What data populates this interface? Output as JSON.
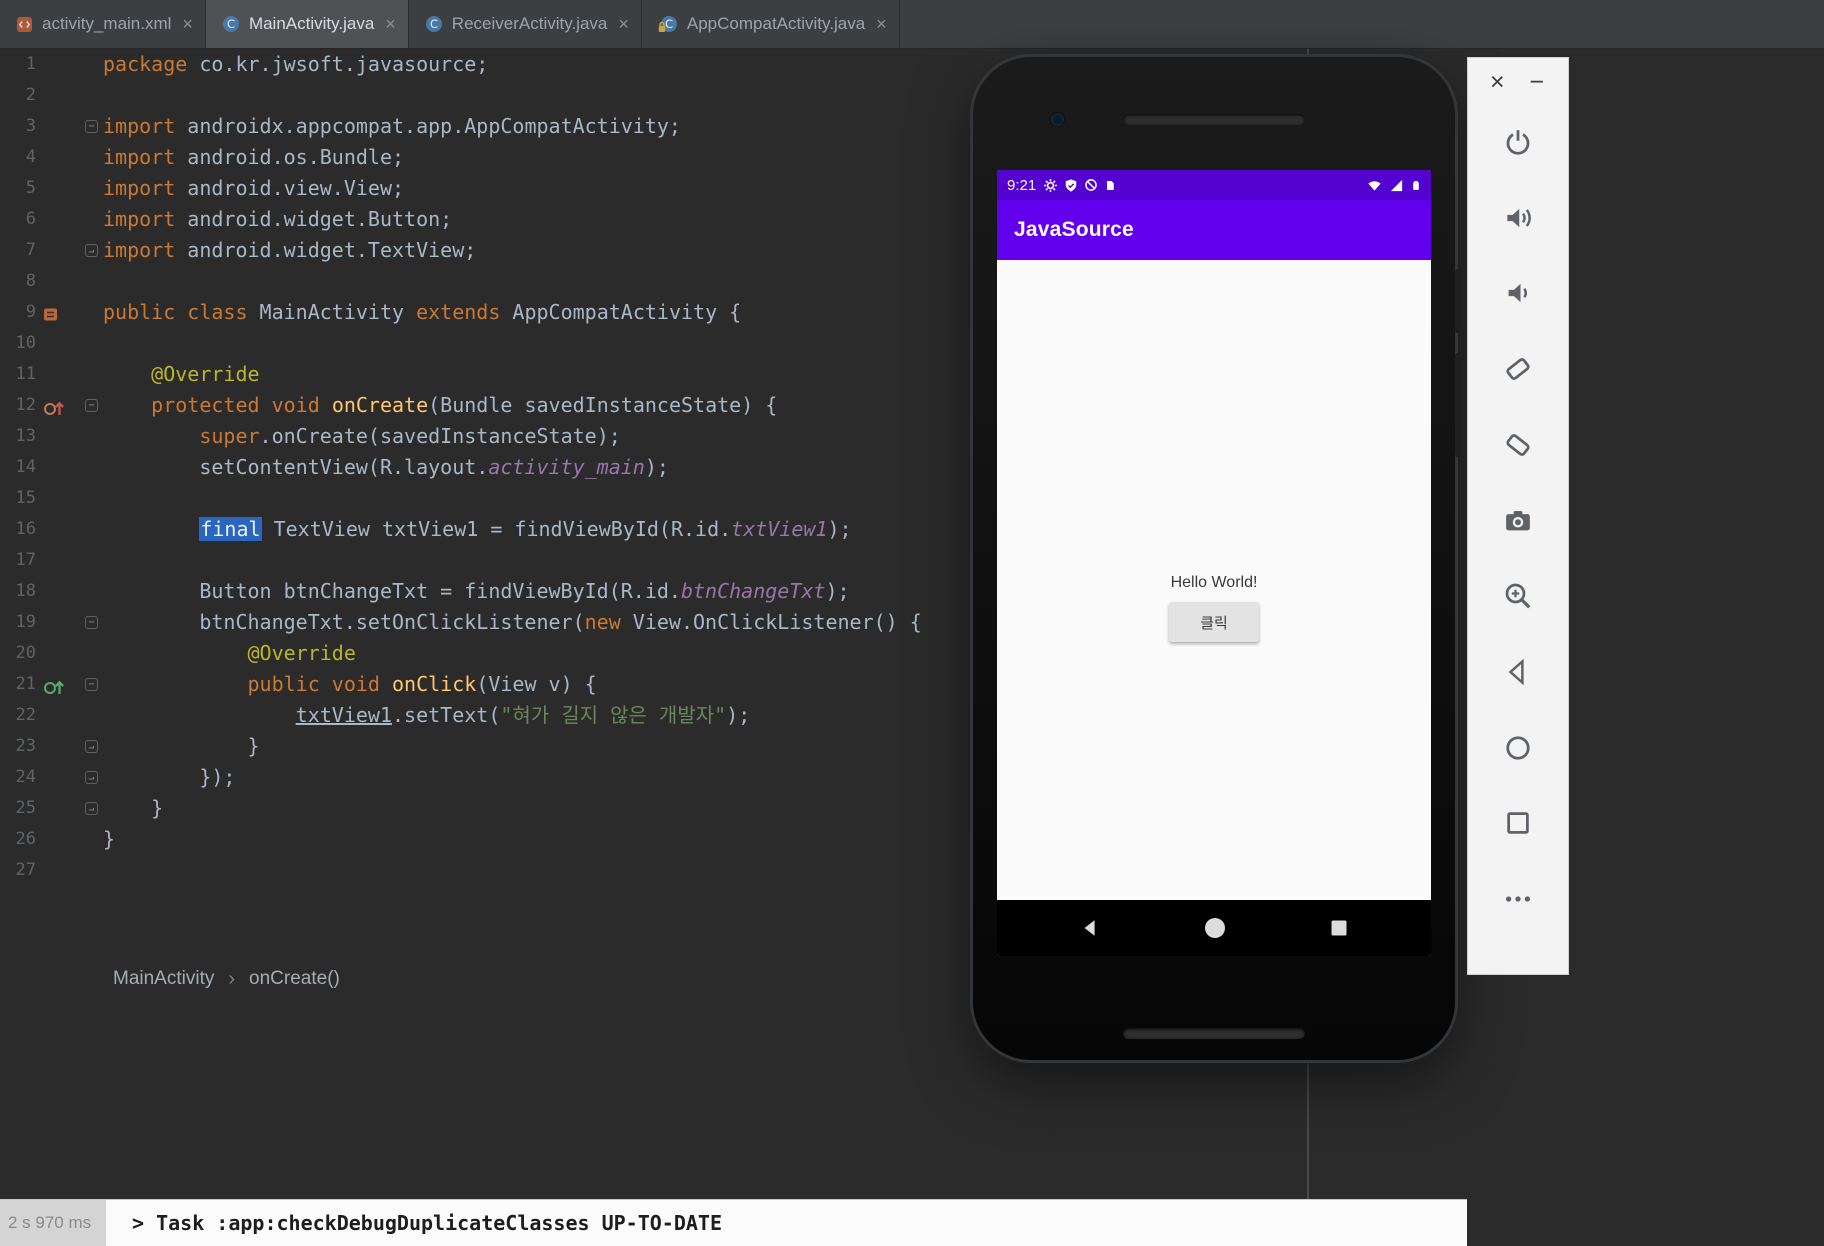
{
  "ui": {
    "close_glyph": "×",
    "minimize_glyph": "−",
    "breadcrumb_separator": "›",
    "fold_start_glyph": "−",
    "fold_end_glyph": "⌐"
  },
  "tabs": [
    {
      "label": "activity_main.xml",
      "icon": "xml-file-icon",
      "active": false
    },
    {
      "label": "MainActivity.java",
      "icon": "java-class-icon",
      "active": true
    },
    {
      "label": "ReceiverActivity.java",
      "icon": "java-class-icon",
      "active": false
    },
    {
      "label": "AppCompatActivity.java",
      "icon": "java-class-locked-icon",
      "active": false
    }
  ],
  "editor": {
    "lines": [
      {
        "n": 1,
        "tokens": [
          [
            "package",
            "k"
          ],
          [
            " co.kr.jwsoft.javasource;",
            "d"
          ]
        ]
      },
      {
        "n": 2,
        "tokens": []
      },
      {
        "n": 3,
        "fold": "start",
        "tokens": [
          [
            "import",
            "k"
          ],
          [
            " androidx.appcompat.app.AppCompatActivity;",
            "d"
          ]
        ]
      },
      {
        "n": 4,
        "tokens": [
          [
            "import",
            "k"
          ],
          [
            " android.os.Bundle;",
            "d"
          ]
        ]
      },
      {
        "n": 5,
        "tokens": [
          [
            "import",
            "k"
          ],
          [
            " android.view.View;",
            "d"
          ]
        ]
      },
      {
        "n": 6,
        "tokens": [
          [
            "import",
            "k"
          ],
          [
            " android.widget.Button;",
            "d"
          ]
        ]
      },
      {
        "n": 7,
        "fold": "end",
        "tokens": [
          [
            "import",
            "k"
          ],
          [
            " android.widget.TextView;",
            "d"
          ]
        ]
      },
      {
        "n": 8,
        "tokens": []
      },
      {
        "n": 9,
        "gutter_icon": "class-marker-icon",
        "tokens": [
          [
            "public",
            "k"
          ],
          [
            " ",
            "d"
          ],
          [
            "class",
            "k"
          ],
          [
            " MainActivity ",
            "d"
          ],
          [
            "extends",
            "k"
          ],
          [
            " AppCompatActivity {",
            "d"
          ]
        ]
      },
      {
        "n": 10,
        "tokens": []
      },
      {
        "n": 11,
        "tokens": [
          [
            "    ",
            "d"
          ],
          [
            "@Override",
            "a"
          ]
        ]
      },
      {
        "n": 12,
        "gutter_icon": "override-marker-red-icon",
        "fold": "start",
        "tokens": [
          [
            "    ",
            "d"
          ],
          [
            "protected",
            "k"
          ],
          [
            " ",
            "d"
          ],
          [
            "void",
            "k"
          ],
          [
            " ",
            "d"
          ],
          [
            "onCreate",
            "m"
          ],
          [
            "(Bundle savedInstanceState) {",
            "d"
          ]
        ]
      },
      {
        "n": 13,
        "tokens": [
          [
            "        ",
            "d"
          ],
          [
            "super",
            "k"
          ],
          [
            ".onCreate(savedInstanceState);",
            "d"
          ]
        ]
      },
      {
        "n": 14,
        "tokens": [
          [
            "        setContentView(R.layout.",
            "d"
          ],
          [
            "activity_main",
            "f"
          ],
          [
            ");",
            "d"
          ]
        ]
      },
      {
        "n": 15,
        "tokens": []
      },
      {
        "n": 16,
        "tokens": [
          [
            "        ",
            "d"
          ],
          [
            "final",
            "sel"
          ],
          [
            " TextView txtView1 = findViewById(R.id.",
            "d"
          ],
          [
            "txtView1",
            "f"
          ],
          [
            ");",
            "d"
          ]
        ]
      },
      {
        "n": 17,
        "tokens": []
      },
      {
        "n": 18,
        "tokens": [
          [
            "        Button btnChangeTxt = findViewById(R.id.",
            "d"
          ],
          [
            "btnChangeTxt",
            "f"
          ],
          [
            ");",
            "d"
          ]
        ]
      },
      {
        "n": 19,
        "fold": "start",
        "tokens": [
          [
            "        btnChangeTxt.setOnClickListener(",
            "d"
          ],
          [
            "new",
            "k"
          ],
          [
            " View.OnClickListener() {",
            "d"
          ]
        ]
      },
      {
        "n": 20,
        "tokens": [
          [
            "            ",
            "d"
          ],
          [
            "@Override",
            "a"
          ]
        ]
      },
      {
        "n": 21,
        "gutter_icon": "override-marker-green-icon",
        "fold": "start",
        "tokens": [
          [
            "            ",
            "d"
          ],
          [
            "public",
            "k"
          ],
          [
            " ",
            "d"
          ],
          [
            "void",
            "k"
          ],
          [
            " ",
            "d"
          ],
          [
            "onClick",
            "m"
          ],
          [
            "(View v) {",
            "d"
          ]
        ]
      },
      {
        "n": 22,
        "tokens": [
          [
            "                ",
            "d"
          ],
          [
            "txtView1",
            "u"
          ],
          [
            ".setText(",
            "d"
          ],
          [
            "\"혀가 길지 않은 개발자\"",
            "s"
          ],
          [
            ");",
            "d"
          ]
        ]
      },
      {
        "n": 23,
        "fold": "end",
        "tokens": [
          [
            "            }",
            "d"
          ]
        ]
      },
      {
        "n": 24,
        "fold": "end",
        "tokens": [
          [
            "        });",
            "d"
          ]
        ]
      },
      {
        "n": 25,
        "fold": "end",
        "tokens": [
          [
            "    }",
            "d"
          ]
        ]
      },
      {
        "n": 26,
        "tokens": [
          [
            "}",
            "d"
          ]
        ]
      },
      {
        "n": 27,
        "tokens": []
      }
    ]
  },
  "breadcrumb": {
    "items": [
      "MainActivity",
      "onCreate()"
    ]
  },
  "build": {
    "duration": "2 s 970 ms",
    "task_line": "> Task :app:checkDebugDuplicateClasses UP-TO-DATE"
  },
  "emulator": {
    "status_bar": {
      "time": "9:21",
      "left_icons": [
        "gear-icon",
        "shield-icon",
        "do-not-disturb-icon",
        "sim-card-icon"
      ],
      "right_icons": [
        "wifi-icon",
        "signal-icon",
        "battery-icon"
      ]
    },
    "app_bar": {
      "title": "JavaSource"
    },
    "content": {
      "hello_text": "Hello World!",
      "button_label": "클릭"
    },
    "nav_buttons": [
      "back",
      "home",
      "overview"
    ]
  },
  "toolbar": {
    "window_controls": [
      "close",
      "minimize"
    ],
    "buttons": [
      "power",
      "volume-up",
      "volume-down",
      "rotate-left",
      "rotate-right",
      "screenshot",
      "zoom",
      "back",
      "home",
      "overview",
      "more"
    ]
  },
  "colors": {
    "editor_bg": "#2b2b2b",
    "tabbar_bg": "#3c3f41",
    "active_tab_bg": "#4e5254",
    "keyword": "#cc7832",
    "annotation": "#bbb529",
    "method": "#ffc66b",
    "string": "#6a8759",
    "field": "#9876aa",
    "editor_text": "#a9b7c6",
    "line_number": "#606366",
    "selection_bg": "#2a65c0",
    "appbar_purple": "#6200ee",
    "statusbar_purple": "#5302cf"
  }
}
